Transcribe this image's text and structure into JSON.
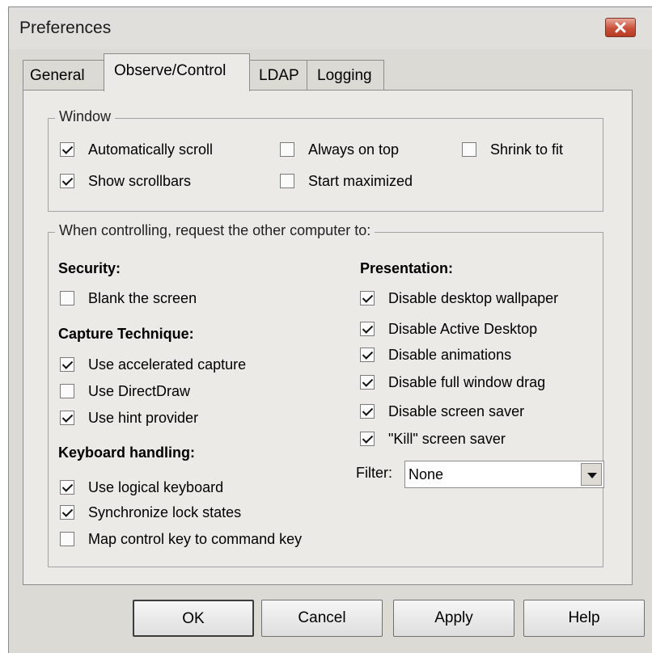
{
  "window": {
    "title": "Preferences",
    "close_icon": "close-icon"
  },
  "tabs": [
    {
      "label": "General"
    },
    {
      "label": "Observe/Control"
    },
    {
      "label": "LDAP"
    },
    {
      "label": "Logging"
    }
  ],
  "window_group": {
    "legend": "Window",
    "options": [
      {
        "label": "Automatically scroll",
        "checked": true
      },
      {
        "label": "Always on top",
        "checked": false
      },
      {
        "label": "Shrink to fit",
        "checked": false
      },
      {
        "label": "Show scrollbars",
        "checked": true
      },
      {
        "label": "Start maximized",
        "checked": false
      }
    ]
  },
  "control_group": {
    "legend": "When controlling, request the other computer to:",
    "security": {
      "heading": "Security:",
      "options": [
        {
          "label": "Blank the screen",
          "checked": false
        }
      ]
    },
    "capture": {
      "heading": "Capture Technique:",
      "options": [
        {
          "label": "Use accelerated capture",
          "checked": true
        },
        {
          "label": "Use DirectDraw",
          "checked": false
        },
        {
          "label": "Use hint provider",
          "checked": true
        }
      ]
    },
    "keyboard": {
      "heading": "Keyboard handling:",
      "options": [
        {
          "label": "Use logical keyboard",
          "checked": true
        },
        {
          "label": "Synchronize lock states",
          "checked": true
        },
        {
          "label": "Map control key to command key",
          "checked": false
        }
      ]
    },
    "presentation": {
      "heading": "Presentation:",
      "options": [
        {
          "label": "Disable desktop wallpaper",
          "checked": true
        },
        {
          "label": "Disable Active Desktop",
          "checked": true
        },
        {
          "label": "Disable animations",
          "checked": true
        },
        {
          "label": "Disable full window drag",
          "checked": true
        },
        {
          "label": "Disable screen saver",
          "checked": true
        },
        {
          "label": "\"Kill\" screen saver",
          "checked": true
        }
      ]
    },
    "filter": {
      "label": "Filter:",
      "value": "None"
    }
  },
  "buttons": {
    "ok": "OK",
    "cancel": "Cancel",
    "apply": "Apply",
    "help": "Help"
  },
  "colors": {
    "close_button": "#c9503a",
    "dialog_bg": "#eceae6"
  }
}
